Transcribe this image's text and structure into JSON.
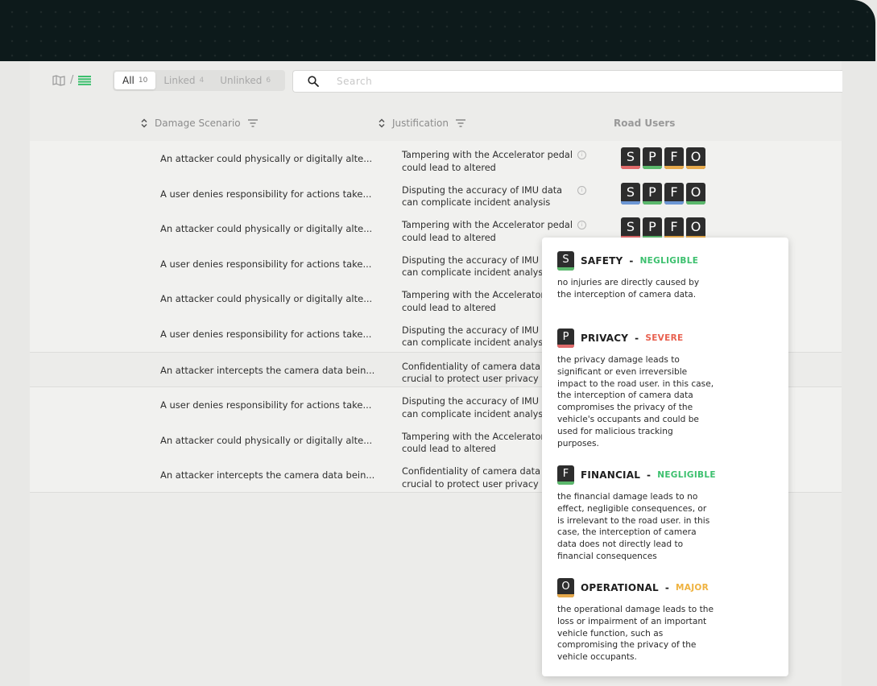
{
  "colors": {
    "safety": "#e06a6a",
    "privacy_bar": "#5bb86c",
    "financial": "#6c96d4",
    "operational": "#e6a94b",
    "negligible": "#3cc06e",
    "severe": "#e8604f",
    "major": "#efb23f"
  },
  "toolbar": {
    "view_separator": "/",
    "filters": [
      {
        "label": "All",
        "count": "10"
      },
      {
        "label": "Linked",
        "count": "4"
      },
      {
        "label": "Unlinked",
        "count": "6"
      }
    ],
    "search_placeholder": "Search"
  },
  "table": {
    "headers": {
      "damage_scenario": "Damage Scenario",
      "justification": "Justification",
      "road_users": "Road Users"
    },
    "rows": [
      {
        "scenario": "An attacker could physically or digitally alte...",
        "justification": "Tampering with the Accelerator pedal could lead to altered"
      },
      {
        "scenario": "A user denies responsibility for actions take...",
        "justification": "Disputing the accuracy of IMU data can complicate incident analysis"
      },
      {
        "scenario": "An attacker could physically or digitally alte...",
        "justification": "Tampering with the Accelerator pedal could lead to altered"
      },
      {
        "scenario": "A user denies responsibility for actions take...",
        "justification": "Disputing the accuracy of IMU data can complicate incident analysis"
      },
      {
        "scenario": "An attacker could physically or digitally alte...",
        "justification": "Tampering with the Accelerator pedal could lead to altered"
      },
      {
        "scenario": "A user denies responsibility for actions take...",
        "justification": "Disputing the accuracy of IMU data can complicate incident analysis"
      },
      {
        "scenario": "An attacker intercepts the camera data bein...",
        "justification": "Confidentiality of camera data is crucial to protect user privacy"
      },
      {
        "scenario": "A user denies responsibility for actions take...",
        "justification": "Disputing the accuracy of IMU data can complicate incident analysis"
      },
      {
        "scenario": "An attacker could physically or digitally alte...",
        "justification": "Tampering with the Accelerator pedal could lead to altered"
      },
      {
        "scenario": "An attacker intercepts the camera data bein...",
        "justification": "Confidentiality of camera data is crucial to protect user privacy"
      }
    ],
    "road_user_letters": [
      "S",
      "P",
      "F",
      "O"
    ],
    "row_badge_colors": [
      [
        "#e06a6a",
        "#5bb86c",
        "#e6a94b",
        "#e6a94b"
      ],
      [
        "#6c96d4",
        "#5bb86c",
        "#6c96d4",
        "#5bb86c"
      ],
      [
        "#e06a6a",
        "#5bb86c",
        "#e6a94b",
        "#e6a94b"
      ]
    ]
  },
  "popover": {
    "sections": [
      {
        "letter": "S",
        "title": "SAFETY",
        "dash": "-",
        "level": "NEGLIGIBLE",
        "level_color": "#3cc06e",
        "bar_color": "#5bb86c",
        "desc": "no injuries are directly caused by the interception of camera data."
      },
      {
        "letter": "P",
        "title": "PRIVACY",
        "dash": "-",
        "level": "SEVERE",
        "level_color": "#e8604f",
        "bar_color": "#e06a6a",
        "desc": "the privacy damage leads to significant or even irreversible impact to the road user. in this case, the interception of camera data compromises the privacy of the vehicle's occupants and could be used for malicious tracking purposes."
      },
      {
        "letter": "F",
        "title": "FINANCIAL",
        "dash": "-",
        "level": "NEGLIGIBLE",
        "level_color": "#3cc06e",
        "bar_color": "#5bb86c",
        "desc": "the financial damage leads to no effect, negligible consequences, or is irrelevant to the road user. in this case, the interception of camera data does not directly lead to financial consequences"
      },
      {
        "letter": "O",
        "title": "OPERATIONAL",
        "dash": "-",
        "level": "MAJOR",
        "level_color": "#efb23f",
        "bar_color": "#e6a94b",
        "desc": "the operational damage leads to the loss or impairment of an important vehicle function, such as compromising the privacy of the vehicle occupants."
      }
    ]
  }
}
